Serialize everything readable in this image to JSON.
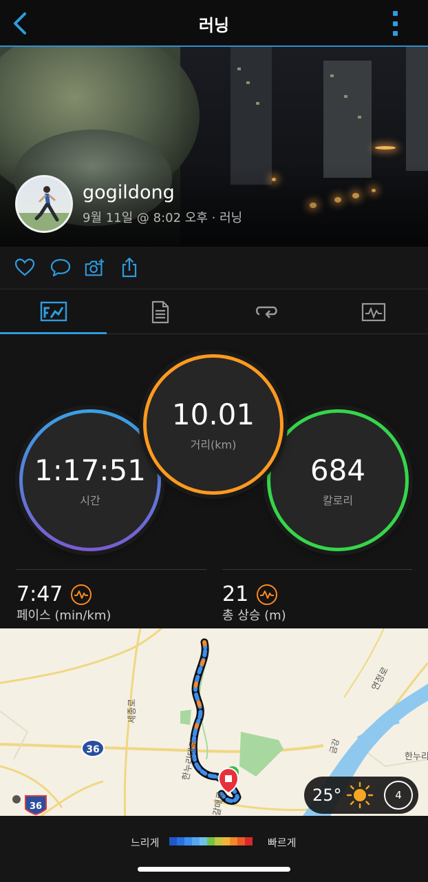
{
  "header": {
    "title": "러닝"
  },
  "profile": {
    "username": "gogildong",
    "subline": "9월 11일 @ 8:02 오후 · 러닝"
  },
  "stats": {
    "time": {
      "value": "1:17:51",
      "label": "시간"
    },
    "distance": {
      "value": "10.01",
      "label": "거리(km)"
    },
    "calories": {
      "value": "684",
      "label": "칼로리"
    }
  },
  "metrics": {
    "pace": {
      "value": "7:47",
      "label": "페이스 (min/km)"
    },
    "ascent": {
      "value": "21",
      "label": "총 상승 (m)"
    }
  },
  "map": {
    "road_labels": [
      "세종로",
      "한누리대로",
      "갈매로",
      "연정로",
      "금강",
      "한누리"
    ],
    "route_shields": [
      "36",
      "36"
    ]
  },
  "weather": {
    "temp": "25°",
    "wind": "4"
  },
  "legend": {
    "slow": "느리게",
    "fast": "빠르게",
    "colors": [
      "#1f58c8",
      "#2a6fe0",
      "#3c8ef0",
      "#56a6f2",
      "#6ec0e8",
      "#72c24a",
      "#c0c93c",
      "#f3b23a",
      "#f2892a",
      "#ec5a26",
      "#d8282a"
    ]
  },
  "colors": {
    "accent": "#2f9ce0",
    "distance": "#ff9a1f",
    "calories": "#35d64a",
    "time_top": "#3aa0e6",
    "time_bottom": "#7a5cd0"
  }
}
